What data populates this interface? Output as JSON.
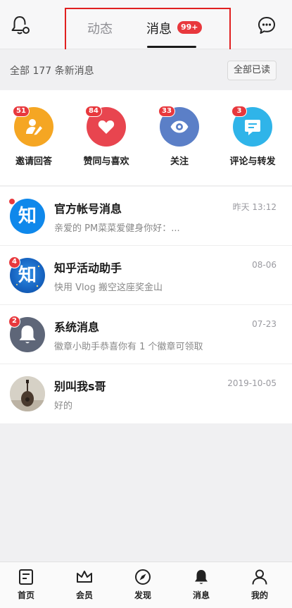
{
  "header": {
    "tabs": [
      {
        "label": "动态",
        "active": false
      },
      {
        "label": "消息",
        "active": true,
        "badge": "99+"
      }
    ],
    "left_icon": "notification-settings-icon",
    "right_icon": "chat-bubble-icon"
  },
  "summary": {
    "text": "全部 177 条新消息",
    "mark_all_read": "全部已读"
  },
  "categories": [
    {
      "label": "邀请回答",
      "badge": "51",
      "icon": "invite-answer-icon",
      "color": "#f5a623"
    },
    {
      "label": "赞同与喜欢",
      "badge": "84",
      "icon": "heart-icon",
      "color": "#e8454f"
    },
    {
      "label": "关注",
      "badge": "33",
      "icon": "eye-icon",
      "color": "#5b7fc7"
    },
    {
      "label": "评论与转发",
      "badge": "3",
      "icon": "comment-icon",
      "color": "#2fb4e9"
    }
  ],
  "messages": [
    {
      "title": "官方帐号消息",
      "time": "昨天 13:12",
      "preview": "亲爱的 PM菜菜爱健身你好：...",
      "avatar_text": "知",
      "badge": "dot"
    },
    {
      "title": "知乎活动助手",
      "time": "08-06",
      "preview": "快用 Vlog 搬空这座奖金山",
      "avatar_text": "知",
      "badge": "4"
    },
    {
      "title": "系统消息",
      "time": "07-23",
      "preview": "徽章小助手恭喜你有 1 个徽章可领取",
      "avatar_text": "",
      "badge": "2"
    },
    {
      "title": "别叫我s哥",
      "time": "2019-10-05",
      "preview": "好的",
      "avatar_text": "",
      "badge": ""
    }
  ],
  "bottom_nav": [
    {
      "label": "首页",
      "icon": "home-icon"
    },
    {
      "label": "会员",
      "icon": "crown-icon"
    },
    {
      "label": "发现",
      "icon": "compass-icon"
    },
    {
      "label": "消息",
      "icon": "bell-icon"
    },
    {
      "label": "我的",
      "icon": "person-icon"
    }
  ],
  "colors": {
    "badge_red": "#e8383d",
    "zhihu_blue": "#0f88eb",
    "system_gray": "#5e6678"
  }
}
